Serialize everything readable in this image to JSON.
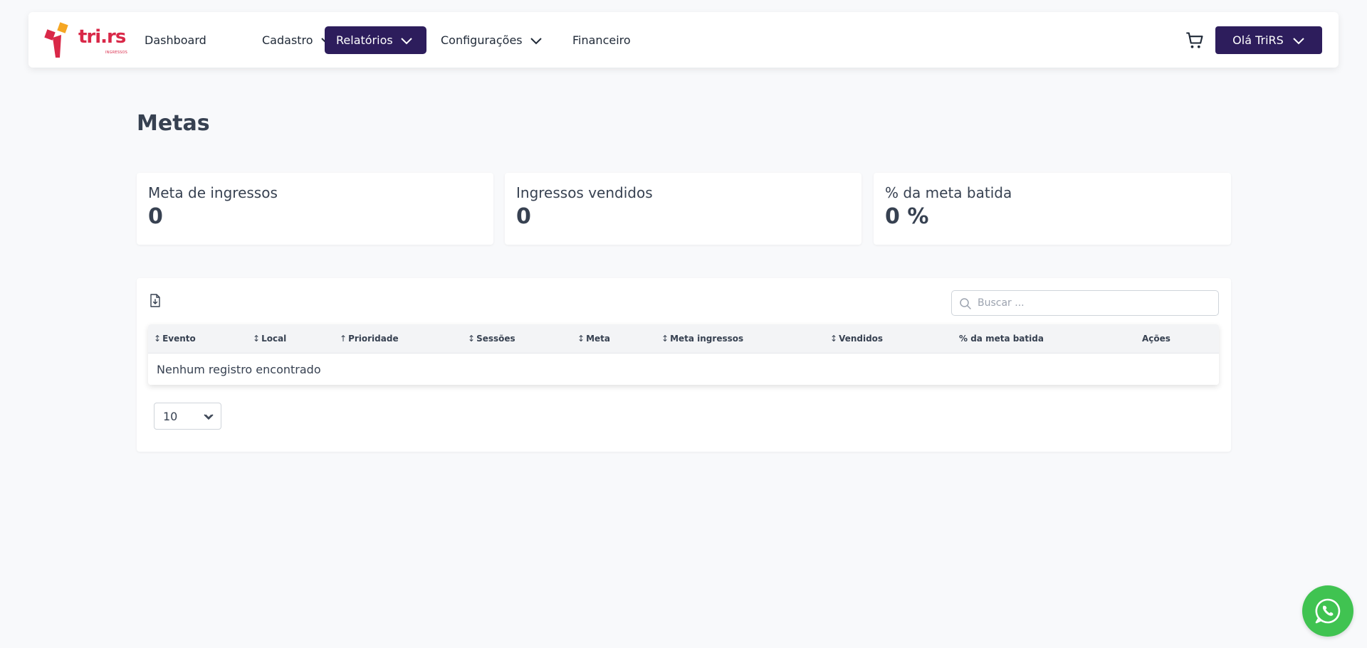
{
  "brand": {
    "logo_text": "tri.rs",
    "logo_subtext": "INGRESSOS",
    "logo_colors": [
      "#d92848",
      "#f5a623"
    ]
  },
  "nav": {
    "items": [
      {
        "label": "Dashboard",
        "has_dropdown": false,
        "active": false
      },
      {
        "label": "Cadastro",
        "has_dropdown": true,
        "active": false
      },
      {
        "label": "Relatórios",
        "has_dropdown": true,
        "active": true
      },
      {
        "label": "Configurações",
        "has_dropdown": true,
        "active": false
      },
      {
        "label": "Financeiro",
        "has_dropdown": false,
        "active": false
      }
    ],
    "cart_icon": "cart-icon",
    "user_label": "Olá TriRS",
    "accent_color": "#2d1d5c"
  },
  "page": {
    "title": "Metas"
  },
  "cards": [
    {
      "label": "Meta de ingressos",
      "value": "0"
    },
    {
      "label": "Ingressos vendidos",
      "value": "0"
    },
    {
      "label": "% da meta batida",
      "value": "0 %"
    }
  ],
  "table": {
    "export_icon": "file-export-icon",
    "search_placeholder": "Buscar ...",
    "columns": [
      {
        "label": "Evento",
        "sort": "↕"
      },
      {
        "label": "Local",
        "sort": "↕"
      },
      {
        "label": "Prioridade",
        "sort": "↑"
      },
      {
        "label": "Sessões",
        "sort": "↕"
      },
      {
        "label": "Meta",
        "sort": "↕"
      },
      {
        "label": "Meta ingressos",
        "sort": "↕"
      },
      {
        "label": "Vendidos",
        "sort": "↕"
      },
      {
        "label": "% da meta batida",
        "sort": ""
      },
      {
        "label": "Ações",
        "sort": ""
      }
    ],
    "empty_message": "Nenhum registro encontrado",
    "page_size": "10"
  },
  "whatsapp": {
    "icon": "whatsapp-icon",
    "color": "#40c351"
  }
}
